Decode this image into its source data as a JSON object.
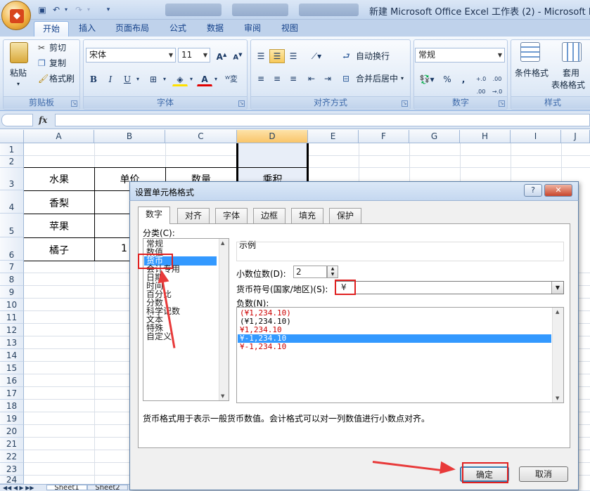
{
  "window": {
    "title": "新建 Microsoft Office Excel 工作表 (2) - Microsoft Exce"
  },
  "ribbon": {
    "tabs": [
      "开始",
      "插入",
      "页面布局",
      "公式",
      "数据",
      "审阅",
      "视图"
    ],
    "clipboard": {
      "paste": "粘贴",
      "cut": "剪切",
      "copy": "复制",
      "format_painter": "格式刷",
      "label": "剪贴板"
    },
    "font": {
      "name": "宋体",
      "size": "11",
      "label": "字体",
      "bold": "B",
      "italic": "I",
      "underline": "U"
    },
    "alignment": {
      "wrap": "自动换行",
      "merge": "合并后居中",
      "label": "对齐方式"
    },
    "number": {
      "format": "常规",
      "label": "数字",
      "percent": "%",
      "comma": ","
    },
    "styles": {
      "conditional": "条件格式",
      "table1": "套用",
      "table2": "表格格式",
      "label": "样式"
    }
  },
  "formula_bar": {
    "fx": "fx"
  },
  "grid": {
    "columns": [
      "A",
      "B",
      "C",
      "D",
      "E",
      "F",
      "G",
      "H",
      "I",
      "J"
    ],
    "rows": [
      "1",
      "2",
      "3",
      "4",
      "5",
      "6",
      "7",
      "8",
      "9",
      "10",
      "11",
      "12",
      "13",
      "14",
      "15",
      "16",
      "17",
      "18",
      "19",
      "20",
      "21",
      "22",
      "23",
      "24"
    ],
    "cells": {
      "A3": "水果",
      "B3": "单价",
      "C3": "数量",
      "D3": "乘积",
      "A4": "香梨",
      "A5": "苹果",
      "A6": "橘子",
      "B6": "1"
    }
  },
  "sheet_tabs": [
    "Sheet1",
    "Sheet2"
  ],
  "dialog": {
    "title": "设置单元格格式",
    "help": "?",
    "close": "✕",
    "tabs": [
      "数字",
      "对齐",
      "字体",
      "边框",
      "填充",
      "保护"
    ],
    "category_label": "分类(C):",
    "categories": [
      "常规",
      "数值",
      "货币",
      "会计专用",
      "日期",
      "时间",
      "百分比",
      "分数",
      "科学记数",
      "文本",
      "特殊",
      "自定义"
    ],
    "selected_category": "货币",
    "sample_label": "示例",
    "decimal_label": "小数位数(D):",
    "decimal_value": "2",
    "currency_label": "货币符号(国家/地区)(S):",
    "currency_value": "¥",
    "negative_label": "负数(N):",
    "negative_options": [
      "(¥1,234.10)",
      "(¥1,234.10)",
      "¥1,234.10",
      "¥-1,234.10",
      "¥-1,234.10"
    ],
    "description": "货币格式用于表示一般货币数值。会计格式可以对一列数值进行小数点对齐。",
    "ok": "确定",
    "cancel": "取消",
    "colors": {
      "selection": "#3399ff",
      "negative_red": "#cc0000",
      "annotation": "#e02020"
    }
  }
}
